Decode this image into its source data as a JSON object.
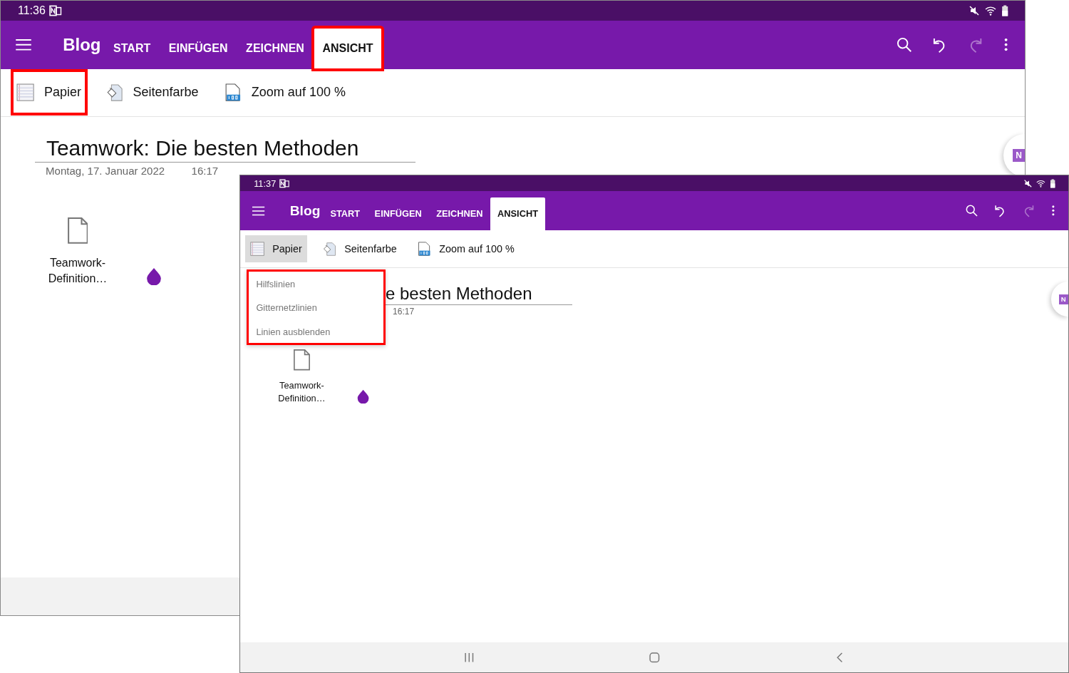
{
  "screens": [
    {
      "status_bar": {
        "time": "11:36"
      },
      "toolbar": {
        "notebook": "Blog",
        "tabs": [
          {
            "label": "START",
            "selected": false,
            "highlighted": false
          },
          {
            "label": "EINFÜGEN",
            "selected": false,
            "highlighted": false
          },
          {
            "label": "ZEICHNEN",
            "selected": false,
            "highlighted": false
          },
          {
            "label": "ANSICHT",
            "selected": true,
            "highlighted": true
          }
        ],
        "redo": {
          "disabled": true
        }
      },
      "ribbon": [
        {
          "kind": "paper",
          "label": "Papier",
          "pressed": false,
          "highlighted": true
        },
        {
          "kind": "page-color",
          "label": "Seitenfarbe",
          "pressed": false
        },
        {
          "kind": "zoom",
          "label": "Zoom auf 100 %",
          "pressed": false
        }
      ],
      "side_button": {
        "label": "N"
      },
      "page": {
        "title": "Teamwork: Die besten Methoden",
        "date": "Montag, 17. Januar 2022",
        "time": "16:17",
        "attachment": {
          "name": "Teamwork-Definition…"
        }
      },
      "nav_buttons": false
    },
    {
      "status_bar": {
        "time": "11:37"
      },
      "toolbar": {
        "notebook": "Blog",
        "tabs": [
          {
            "label": "START",
            "selected": false,
            "highlighted": false
          },
          {
            "label": "EINFÜGEN",
            "selected": false,
            "highlighted": false
          },
          {
            "label": "ZEICHNEN",
            "selected": false,
            "highlighted": false
          },
          {
            "label": "ANSICHT",
            "selected": true,
            "highlighted": false
          }
        ],
        "redo": {
          "disabled": true
        }
      },
      "ribbon": [
        {
          "kind": "paper",
          "label": "Papier",
          "pressed": true
        },
        {
          "kind": "page-color",
          "label": "Seitenfarbe",
          "pressed": false
        },
        {
          "kind": "zoom",
          "label": "Zoom auf 100 %",
          "pressed": false
        }
      ],
      "menu": {
        "highlighted": true,
        "items": [
          "Hilfslinien",
          "Gitternetzlinien",
          "Linien ausblenden"
        ]
      },
      "side_button": {
        "label": "N"
      },
      "page": {
        "title": "e besten Methoden",
        "time": "16:17",
        "attachment": {
          "name": "Teamwork-Definition…"
        }
      },
      "nav_buttons": true
    }
  ]
}
